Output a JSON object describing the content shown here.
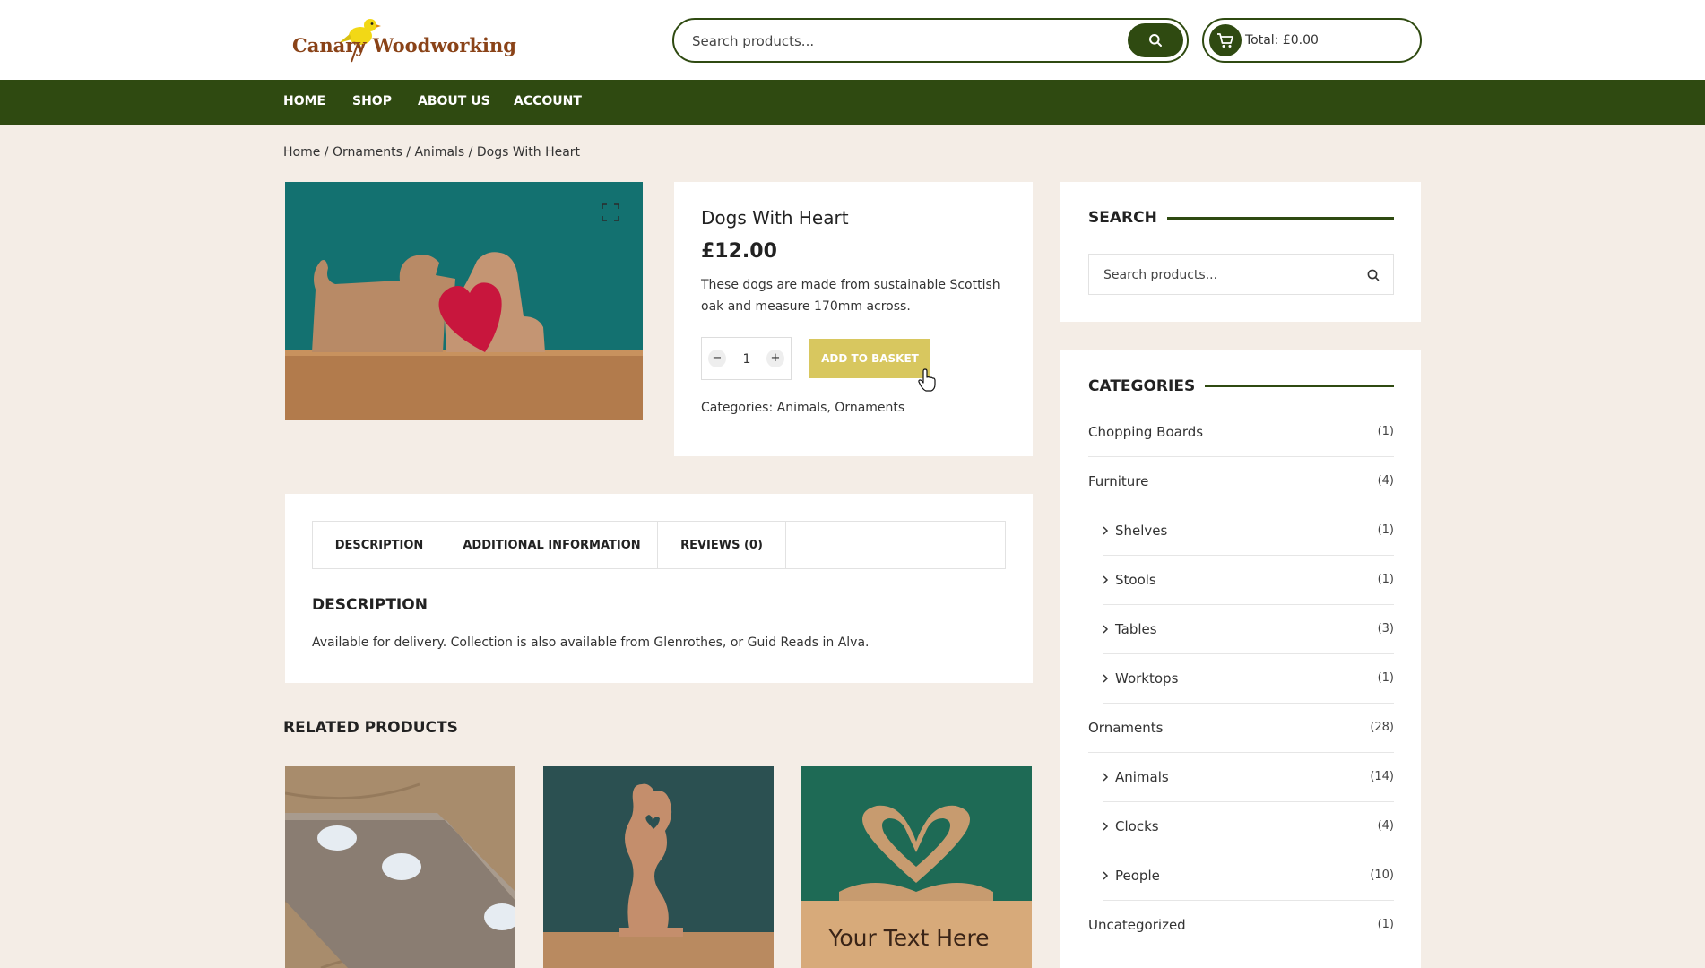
{
  "brand": {
    "name": "Canary Woodworking"
  },
  "header": {
    "search_placeholder": "Search products...",
    "cart_total": "Total: £0.00"
  },
  "nav": {
    "items": [
      "HOME",
      "SHOP",
      "ABOUT US",
      "ACCOUNT"
    ]
  },
  "breadcrumb": {
    "home": "Home",
    "sep": " / ",
    "level1": "Ornaments",
    "level2": "Animals",
    "current": "Dogs With Heart"
  },
  "product": {
    "title": "Dogs With Heart",
    "price": "£12.00",
    "description": "These dogs are made from sustainable Scottish oak and measure 170mm across.",
    "quantity": "1",
    "minus": "−",
    "plus": "+",
    "add_button": "ADD TO BASKET",
    "categories_label": "Categories: ",
    "category_1": "Animals",
    "category_sep": ", ",
    "category_2": "Ornaments"
  },
  "tabs": {
    "items": [
      "DESCRIPTION",
      "ADDITIONAL INFORMATION",
      "REVIEWS (0)"
    ]
  },
  "description_panel": {
    "heading": "DESCRIPTION",
    "text": "Available for delivery. Collection is also available from Glenrothes, or Guid Reads in Alva."
  },
  "related": {
    "heading": "RELATED PRODUCTS",
    "swan_caption": "Your Text Here"
  },
  "sidebar": {
    "search_heading": "SEARCH",
    "search_placeholder": "Search products...",
    "categories_heading": "CATEGORIES",
    "categories": [
      {
        "name": "Chopping Boards",
        "count": "(1)",
        "sub": false
      },
      {
        "name": "Furniture",
        "count": "(4)",
        "sub": false
      },
      {
        "name": "Shelves",
        "count": "(1)",
        "sub": true
      },
      {
        "name": "Stools",
        "count": "(1)",
        "sub": true
      },
      {
        "name": "Tables",
        "count": "(3)",
        "sub": true
      },
      {
        "name": "Worktops",
        "count": "(1)",
        "sub": true
      },
      {
        "name": "Ornaments",
        "count": "(28)",
        "sub": false
      },
      {
        "name": "Animals",
        "count": "(14)",
        "sub": true
      },
      {
        "name": "Clocks",
        "count": "(4)",
        "sub": true
      },
      {
        "name": "People",
        "count": "(10)",
        "sub": true
      },
      {
        "name": "Uncategorized",
        "count": "(1)",
        "sub": false
      }
    ]
  },
  "colors": {
    "accent": "#2f4a11",
    "button": "#d8c75f",
    "background": "#f4ede6",
    "logo": "#8a4318"
  },
  "icons": [
    "canary-logo-icon",
    "search-icon",
    "cart-icon",
    "fullscreen-icon",
    "chevron-right-icon",
    "hand-pointer-icon"
  ]
}
